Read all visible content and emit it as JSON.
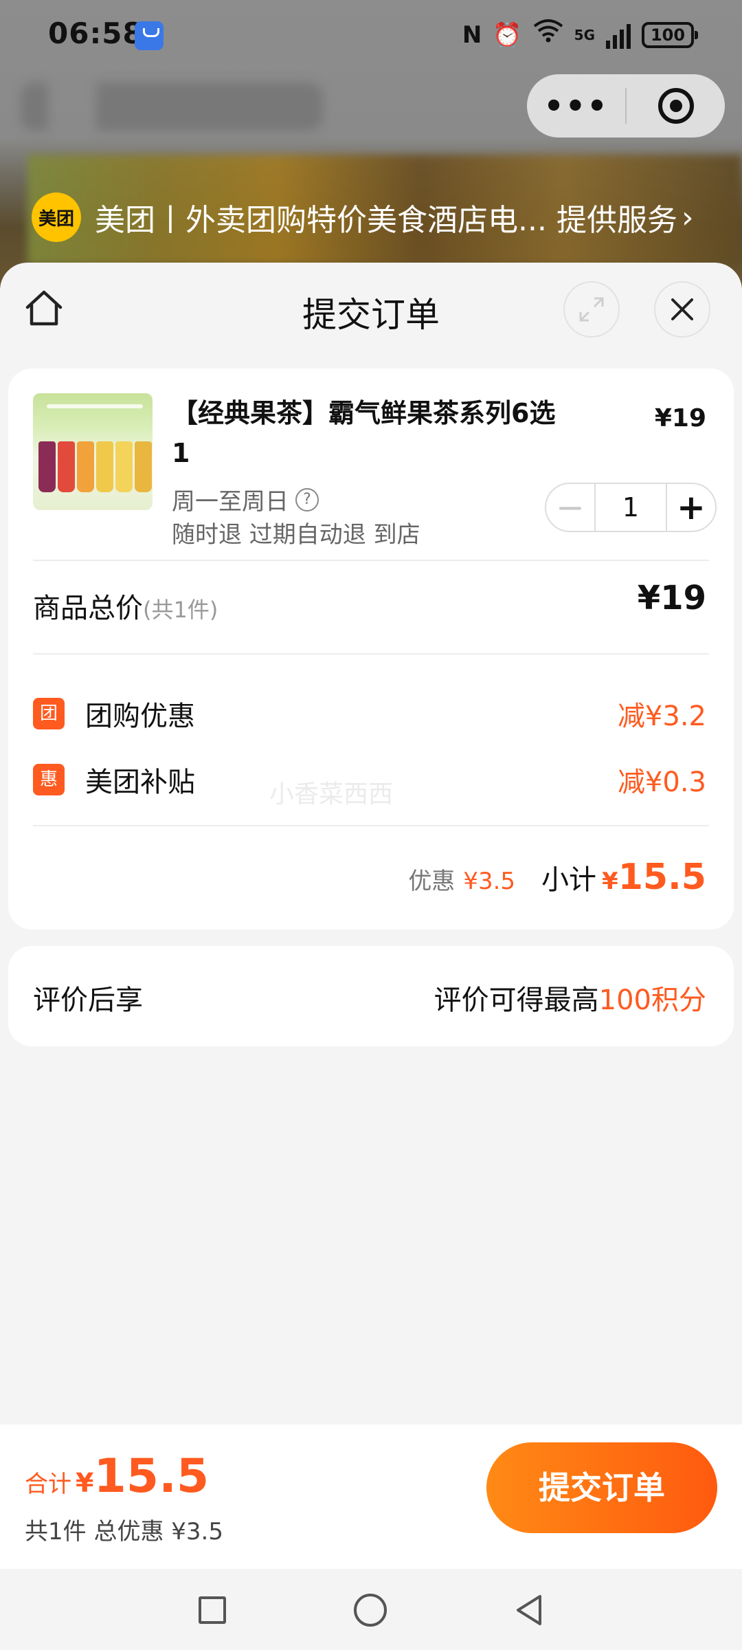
{
  "status_bar": {
    "time": "06:58",
    "battery": "100",
    "network": "5G"
  },
  "mini_program": {
    "provider_logo": "美团",
    "provider_text": "美团丨外卖团购特价美食酒店电... 提供服务",
    "icons": [
      "more-icon",
      "close-circle-icon"
    ]
  },
  "sheet": {
    "title": "提交订单",
    "icons": [
      "home-icon",
      "expand-icon",
      "close-icon"
    ]
  },
  "order": {
    "product_name": "【经典果茶】霸气鲜果茶系列6选1",
    "price": "¥19",
    "valid_days": "周一至周日",
    "policy": "随时退 过期自动退 到店",
    "quantity": "1",
    "total_label": "商品总价",
    "total_count": "(共1件)",
    "total_value": "¥19",
    "discounts": [
      {
        "badge": "团",
        "label": "团购优惠",
        "value": "减¥3.2"
      },
      {
        "badge": "惠",
        "label": "美团补贴",
        "value": "减¥0.3"
      }
    ],
    "watermark": "小香菜西西",
    "discount_label": "优惠",
    "discount_value": "¥3.5",
    "subtotal_label": "小计",
    "subtotal_currency": "¥",
    "subtotal_value": "15.5"
  },
  "review": {
    "left": "评价后享",
    "right_prefix": "评价可得最高",
    "right_highlight": "100积分"
  },
  "bottom_bar": {
    "total_label": "合计",
    "currency": "¥",
    "total_value": "15.5",
    "summary": "共1件 总优惠 ¥3.5",
    "submit_label": "提交订单"
  },
  "colors": {
    "accent": "#ff5a1f",
    "button_gradient_start": "#ff8a15",
    "button_gradient_end": "#ff5a0f",
    "meituan_yellow": "#ffc300"
  }
}
